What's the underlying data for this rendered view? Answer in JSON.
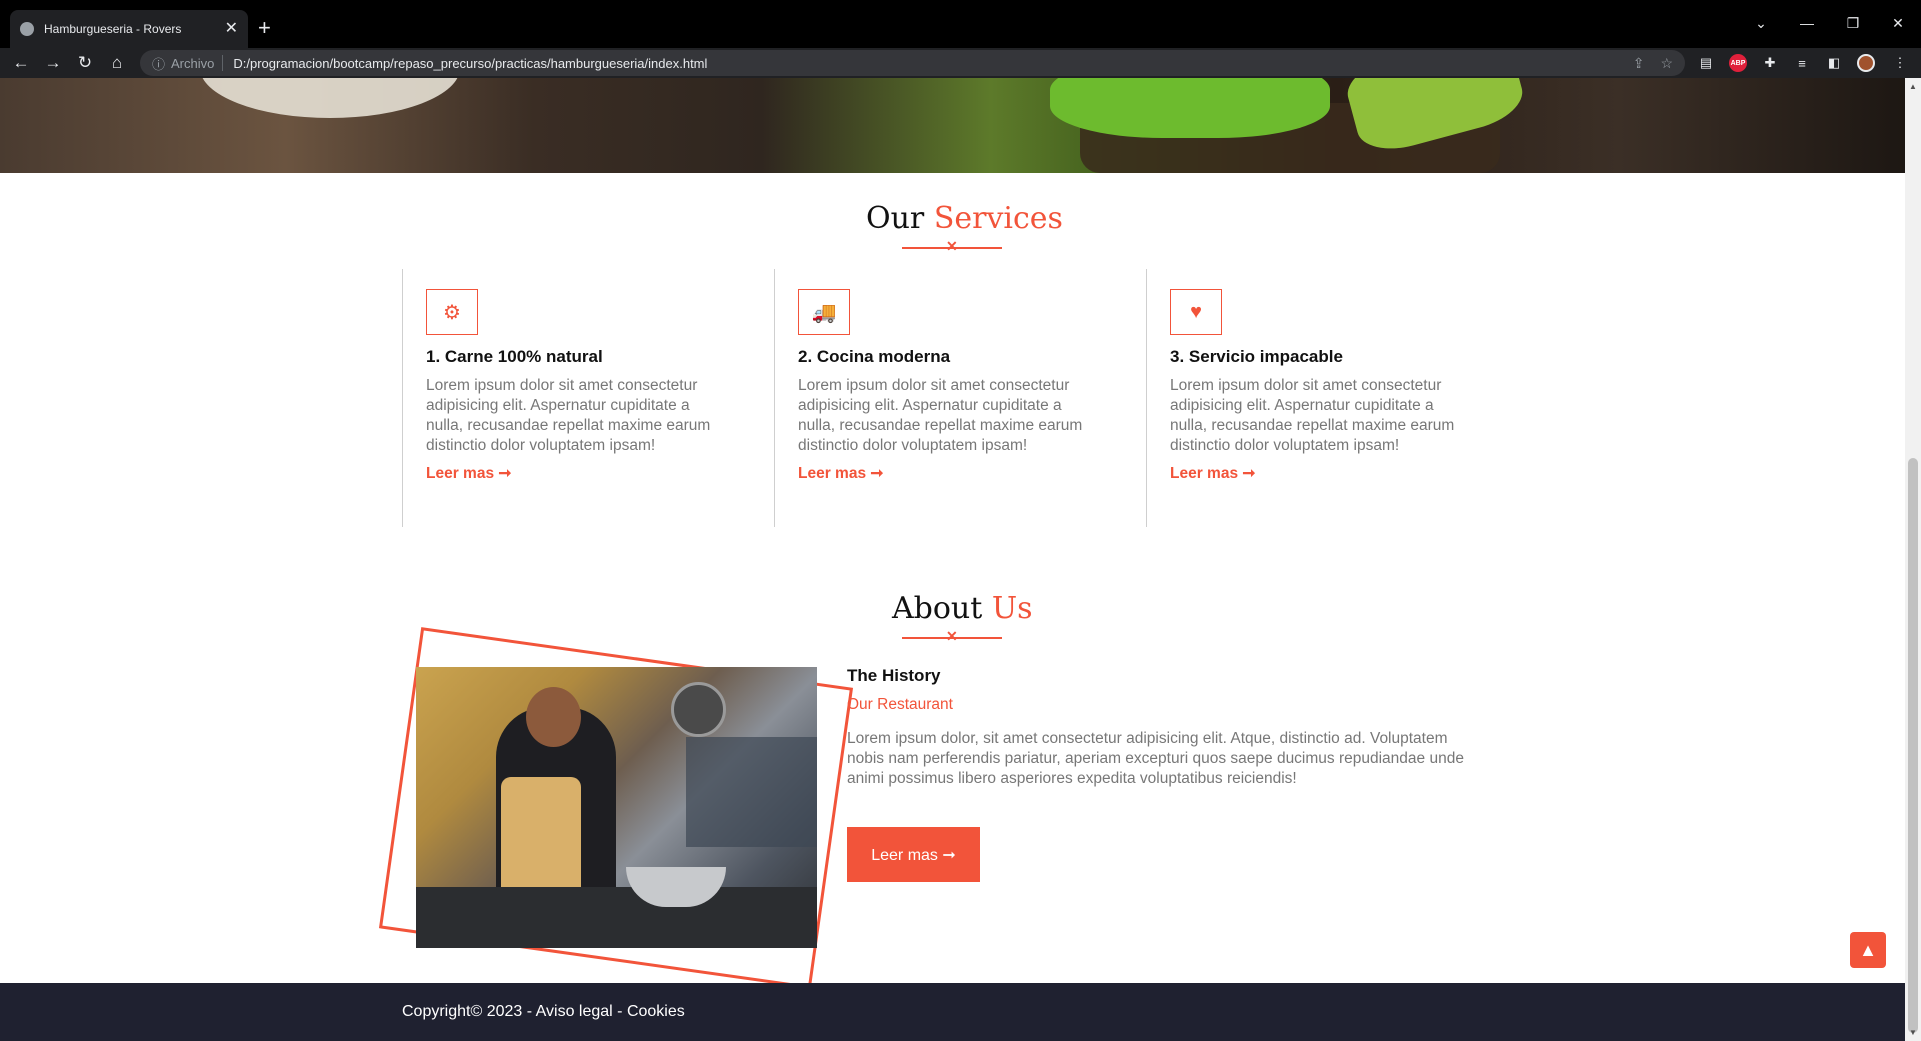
{
  "browser": {
    "tab_title": "Hamburgueseria - Rovers",
    "tab_close": "✕",
    "new_tab": "+",
    "address_scheme": "Archivo",
    "address_url": "D:/programacion/bootcamp/repaso_precurso/practicas/hamburgueseria/index.html",
    "nav": {
      "back": "←",
      "forward": "→",
      "reload": "↻",
      "home": "⌂"
    },
    "window": {
      "list": "⌄",
      "minimize": "—",
      "restore": "❐",
      "close": "✕"
    },
    "extensions": [
      "share-icon",
      "star-icon",
      "media-icon",
      "abp-icon",
      "puzzle-icon",
      "reading-list-icon",
      "side-panel-icon",
      "profile-avatar"
    ],
    "abp_label": "ABP"
  },
  "services": {
    "title_plain": "Our",
    "title_accent": "Services",
    "items": [
      {
        "icon": "gears-icon",
        "glyph": "⚙",
        "title": "1. Carne 100% natural",
        "text": "Lorem ipsum dolor sit amet consectetur adipisicing elit. Aspernatur cupiditate a nulla, recusandae repellat maxime earum distinctio dolor voluptatem ipsam!",
        "link": "Leer mas ➞"
      },
      {
        "icon": "truck-icon",
        "glyph": "🚚",
        "title": "2. Cocina moderna",
        "text": "Lorem ipsum dolor sit amet consectetur adipisicing elit. Aspernatur cupiditate a nulla, recusandae repellat maxime earum distinctio dolor voluptatem ipsam!",
        "link": "Leer mas ➞"
      },
      {
        "icon": "heart-icon",
        "glyph": "♥",
        "title": "3. Servicio impacable",
        "text": "Lorem ipsum dolor sit amet consectetur adipisicing elit. Aspernatur cupiditate a nulla, recusandae repellat maxime earum distinctio dolor voluptatem ipsam!",
        "link": "Leer mas ➞"
      }
    ]
  },
  "about": {
    "title_plain": "About",
    "title_accent": "Us",
    "heading": "The History",
    "subheading": "Our Restaurant",
    "text": "Lorem ipsum dolor, sit amet consectetur adipisicing elit. Atque, distinctio ad. Voluptatem nobis nam perferendis pariatur, aperiam excepturi quos saepe ducimus repudiandae unde animi possimus libero asperiores expedita voluptatibus reiciendis!",
    "button": "Leer mas ➞"
  },
  "footer": {
    "copyright": "Copyright© 2023 - Aviso legal - Cookies"
  },
  "colors": {
    "accent": "#f2543a",
    "footer_bg": "#1f2130",
    "text_muted": "#777777"
  }
}
